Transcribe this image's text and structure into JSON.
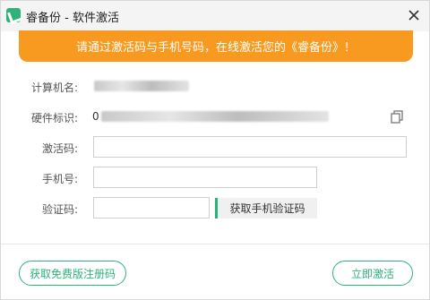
{
  "window": {
    "title": "睿备份 - 软件激活",
    "app_icon": "app-logo-icon",
    "close_icon": "close-icon"
  },
  "banner": {
    "text": "请通过激活码与手机号码，在线激活您的《睿备份》！",
    "color": "#f89a1f"
  },
  "form": {
    "computer_name_label": "计算机名:",
    "hardware_id_label": "硬件标识:",
    "hardware_id_first_char": "0",
    "activation_code_label": "激活码:",
    "activation_code_value": "",
    "phone_label": "手机号:",
    "phone_value": "",
    "verify_code_label": "验证码:",
    "verify_code_value": "",
    "get_code_button": "获取手机验证码"
  },
  "footer": {
    "free_code_button": "获取免费版注册码",
    "activate_button": "立即激活"
  },
  "colors": {
    "accent": "#2fb27a",
    "banner": "#f89a1f"
  }
}
